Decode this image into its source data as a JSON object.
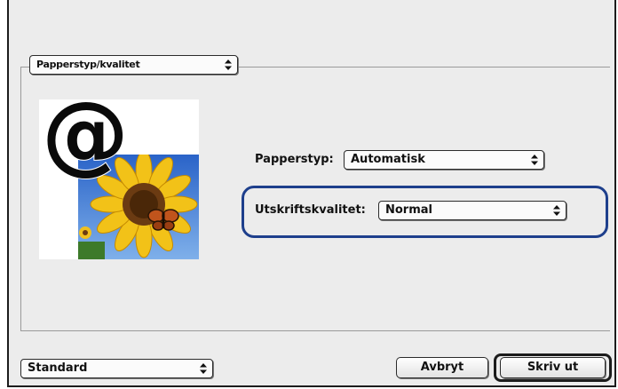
{
  "pane_menu": {
    "selected": "Papperstyp/kvalitet"
  },
  "preview": {
    "image": "at-sign-over-sunflower-butterfly-photo"
  },
  "paper_type": {
    "label": "Papperstyp:",
    "selected": "Automatisk"
  },
  "print_quality": {
    "label": "Utskriftskvalitet:",
    "selected": "Normal",
    "highlight_color": "#1e3f8c"
  },
  "presets": {
    "selected": "Standard"
  },
  "buttons": {
    "cancel": "Avbryt",
    "print": "Skriv ut"
  },
  "icons": {
    "popup_arrows": "up-down-arrows-icon"
  }
}
